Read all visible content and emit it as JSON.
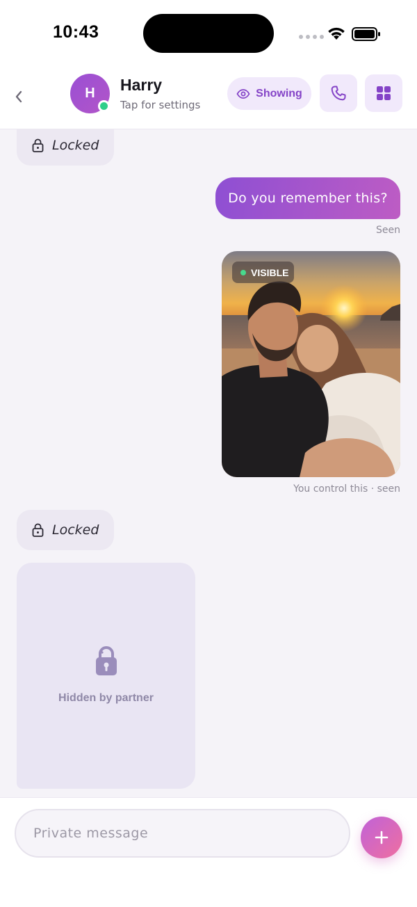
{
  "status_bar": {
    "time": "10:43"
  },
  "header": {
    "contact_name": "Harry",
    "contact_subtitle": "Tap for settings",
    "avatar_initial": "H",
    "showing_label": "Showing",
    "icons": {
      "back": "chevron-left-icon",
      "eye": "eye-icon",
      "call": "phone-icon",
      "grid": "grid-icon"
    }
  },
  "messages": {
    "locked_top": {
      "label": "Locked",
      "icon": "lock-icon"
    },
    "sent_text": {
      "text": "Do you remember this?",
      "status": "Seen"
    },
    "sent_photo": {
      "badge": "VISIBLE",
      "caption": "You control this · seen"
    },
    "locked_bottom": {
      "label": "Locked",
      "icon": "lock-icon"
    },
    "hidden_media": {
      "label": "Hidden by partner",
      "icon": "lock-chat-icon"
    }
  },
  "composer": {
    "placeholder": "Private message",
    "add_icon": "plus-icon"
  },
  "colors": {
    "accent": "#8e4fd3",
    "accent_gradient_end": "#bd5cc4",
    "online": "#2fcf8a",
    "pill_bg": "#f1e9fb",
    "chat_bg": "#f5f3f8"
  }
}
